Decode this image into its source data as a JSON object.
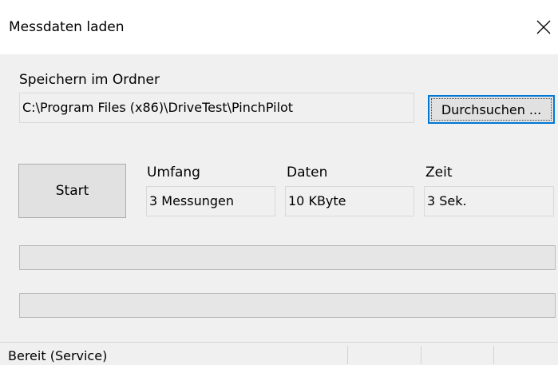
{
  "window": {
    "title": "Messdaten laden",
    "close_icon": "close-icon"
  },
  "folder": {
    "label": "Speichern im Ordner",
    "path": "C:\\Program Files (x86)\\DriveTest\\PinchPilot",
    "browse_label": "Durchsuchen ..."
  },
  "actions": {
    "start_label": "Start"
  },
  "stats": {
    "umfang_label": "Umfang",
    "umfang_value": "3 Messungen",
    "daten_label": "Daten",
    "daten_value": "10 KByte",
    "zeit_label": "Zeit",
    "zeit_value": "3 Sek."
  },
  "progress": {
    "bar1_fraction": 0,
    "bar2_fraction": 0
  },
  "status": {
    "text": "Bereit (Service)",
    "panels": [
      "",
      "",
      ""
    ]
  },
  "colors": {
    "default_button_border": "#0078d7",
    "progress_fill": "#06b025"
  }
}
